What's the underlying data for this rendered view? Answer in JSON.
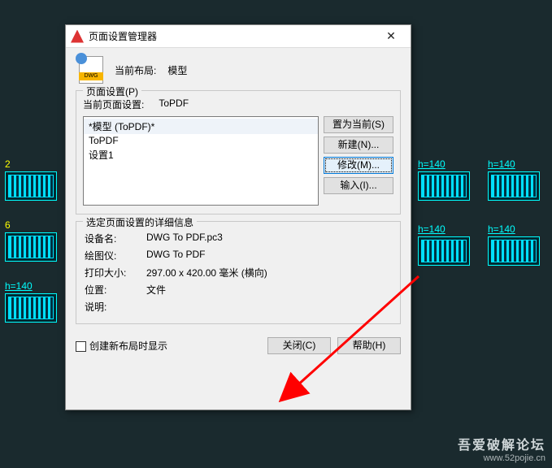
{
  "bg": {
    "left_labels": [
      "2",
      "6"
    ],
    "cyan_label": "h=140",
    "right_label": "h=140"
  },
  "dialog": {
    "title": "页面设置管理器",
    "dwg_badge": "DWG",
    "current_layout_label": "当前布局:",
    "current_layout_value": "模型",
    "page_setup_group": "页面设置(P)",
    "current_page_setup_label": "当前页面设置:",
    "current_page_setup_value": "ToPDF",
    "list": [
      "*模型 (ToPDF)*",
      "ToPDF",
      "设置1"
    ],
    "buttons": {
      "set_current": "置为当前(S)",
      "new": "新建(N)...",
      "modify": "修改(M)...",
      "import": "输入(I)..."
    },
    "details_group": "选定页面设置的详细信息",
    "details": {
      "device_label": "设备名:",
      "device_value": "DWG To PDF.pc3",
      "plotter_label": "绘图仪:",
      "plotter_value": "DWG To PDF",
      "size_label": "打印大小:",
      "size_value": "297.00 x 420.00 毫米 (横向)",
      "location_label": "位置:",
      "location_value": "文件",
      "desc_label": "说明:",
      "desc_value": ""
    },
    "checkbox_label": "创建新布局时显示",
    "close_btn": "关闭(C)",
    "help_btn": "帮助(H)"
  },
  "watermark": {
    "cn": "吾爱破解论坛",
    "url": "www.52pojie.cn"
  }
}
